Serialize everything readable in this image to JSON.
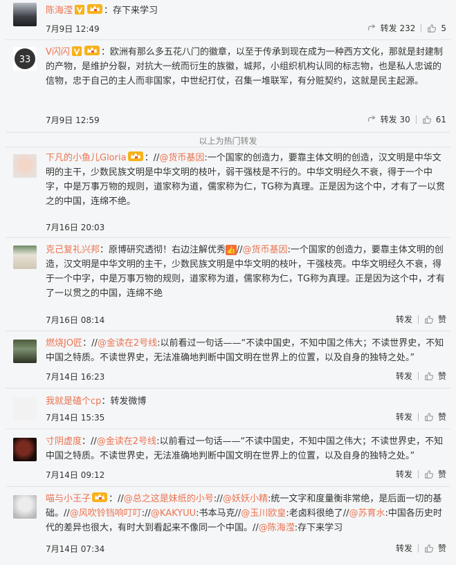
{
  "hot_label": "以上为热门转发",
  "comments": [
    {
      "user": "陈海滢",
      "verified": true,
      "member": true,
      "segments": [
        {
          "t": "text",
          "v": "：存下来学习"
        }
      ],
      "time": "7月9日 12:49",
      "forward_label": "转发 232",
      "like_label": "5"
    },
    {
      "user": "V闪闪",
      "verified": true,
      "member": true,
      "segments": [
        {
          "t": "text",
          "v": "：欧洲有那么多五花八门的徽章，以至于传承到现在成为一种西方文化，那就是封建制的产物，是维护分裂，对抗大一统而衍生的族徽，城邦，小组织机构认同的标志物，也是私人忠诚的信物，忠于自己的主人而非国家，中世纪打仗，召集一堆联军，有分赃契约，这就是民主起源。"
        }
      ],
      "time": "7月9日 12:59",
      "forward_label": "转发 30",
      "like_label": "61"
    },
    {
      "user": "下凡的小鱼儿Gloria",
      "verified": false,
      "member": true,
      "segments": [
        {
          "t": "text",
          "v": "：//"
        },
        {
          "t": "mention",
          "v": "@货币基因"
        },
        {
          "t": "text",
          "v": ":一个国家的创造力，要靠主体文明的创造，汉文明是中华文明的主干，少数民族文明是中华文明的枝叶，弱干强枝是不行的。中华文明经久不衰，得于一个中字，中是万事万物的规则，道家称为道，儒家称为仁，TG称为真理。正是因为这个中，才有了一以贯之的中国，连绵不绝。"
        }
      ],
      "time": "7月16日 20:03",
      "forward_label": "",
      "like_label": ""
    },
    {
      "user": "克己复礼兴邦",
      "verified": false,
      "member": false,
      "segments": [
        {
          "t": "text",
          "v": "：原博研究透彻！右边注解优秀"
        },
        {
          "t": "emoji",
          "v": "👍"
        },
        {
          "t": "text",
          "v": "//"
        },
        {
          "t": "mention",
          "v": "@货币基因"
        },
        {
          "t": "text",
          "v": ":一个国家的创造力，要靠主体文明的创造，汉文明是中华文明的主干，少数民族文明是中华文明的枝叶，干强枝亮。中华文明经久不衰，得于一个中字，中是万事万物的规则，道家称为道，儒家称为仁，TG称为真理。正是因为这个中，才有了一以贯之的中国，连绵不绝"
        }
      ],
      "time": "7月16日 08:14",
      "forward_label": "转发",
      "like_label": "赞"
    },
    {
      "user": "燃烧JO匠",
      "verified": false,
      "member": false,
      "segments": [
        {
          "t": "text",
          "v": "：//"
        },
        {
          "t": "mention",
          "v": "@金读在2号线"
        },
        {
          "t": "text",
          "v": ":以前看过一句话——“不读中国史，不知中国之伟大；不读世界史，不知中国之特质。不读世界史，无法准确地判断中国文明在世界上的位置，以及自身的独特之处。”"
        }
      ],
      "time": "7月14日 16:23",
      "forward_label": "转发",
      "like_label": "赞"
    },
    {
      "user": "我就是磕个cp",
      "verified": false,
      "member": false,
      "segments": [
        {
          "t": "text",
          "v": "：转发微博"
        }
      ],
      "time": "7月14日 15:35",
      "forward_label": "转发",
      "like_label": "赞"
    },
    {
      "user": "寸阴虚度",
      "verified": false,
      "member": false,
      "segments": [
        {
          "t": "text",
          "v": "：//"
        },
        {
          "t": "mention",
          "v": "@金读在2号线"
        },
        {
          "t": "text",
          "v": ":以前看过一句话——“不读中国史，不知中国之伟大；不读世界史，不知中国之特质。不读世界史，无法准确地判断中国文明在世界上的位置，以及自身的独特之处。”"
        }
      ],
      "time": "7月14日 09:12",
      "forward_label": "转发",
      "like_label": "赞"
    },
    {
      "user": "喵与小王子",
      "verified": false,
      "member": true,
      "segments": [
        {
          "t": "text",
          "v": "：//"
        },
        {
          "t": "mention",
          "v": "@总之这是妹纸的小号"
        },
        {
          "t": "text",
          "v": "://"
        },
        {
          "t": "mention",
          "v": "@妖妖小精"
        },
        {
          "t": "text",
          "v": ":统一文字和度量衡非常绝，是后面一切的基础。//"
        },
        {
          "t": "mention",
          "v": "@风吹铃铛响叮叮"
        },
        {
          "t": "text",
          "v": "://"
        },
        {
          "t": "mention",
          "v": "@KAKYUU"
        },
        {
          "t": "text",
          "v": ":书本马克//"
        },
        {
          "t": "mention",
          "v": "@玉川欧皇"
        },
        {
          "t": "text",
          "v": ":老卤料很绝了//"
        },
        {
          "t": "mention",
          "v": "@苏育水"
        },
        {
          "t": "text",
          "v": ":中国各历史时代的差异也很大，有时大到看起来不像同一个中国。//"
        },
        {
          "t": "mention",
          "v": "@陈海滢"
        },
        {
          "t": "text",
          "v": ":存下来学习"
        }
      ],
      "time": "7月14日 07:34",
      "forward_label": "转发",
      "like_label": "赞"
    }
  ],
  "colors": {
    "link": "#eb7350",
    "text": "#333333",
    "muted": "#808080",
    "bg": "#f5f6f7",
    "member_badge": "#f7b21b",
    "verified_badge": "#f7b21b"
  }
}
